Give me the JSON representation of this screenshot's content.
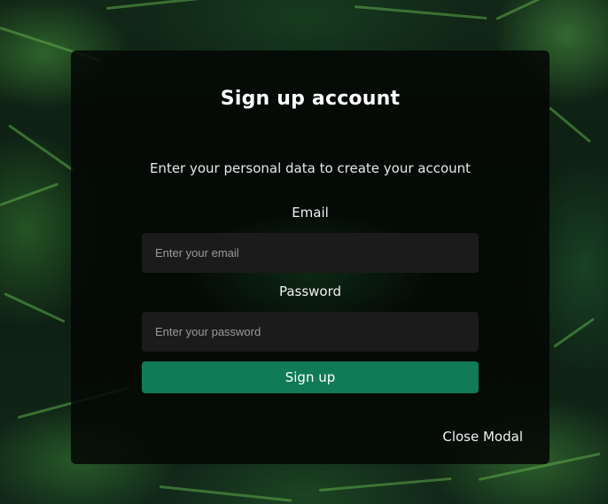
{
  "modal": {
    "title": "Sign up account",
    "subtitle": "Enter your personal data to create your account",
    "email": {
      "label": "Email",
      "placeholder": "Enter your email",
      "value": ""
    },
    "password": {
      "label": "Password",
      "placeholder": "Enter your password",
      "value": ""
    },
    "submit_label": "Sign up",
    "close_label": "Close Modal"
  },
  "colors": {
    "accent": "#117a57",
    "modal_bg": "#040705",
    "input_bg": "#1b1b1b",
    "foliage": "#3c8c37"
  }
}
